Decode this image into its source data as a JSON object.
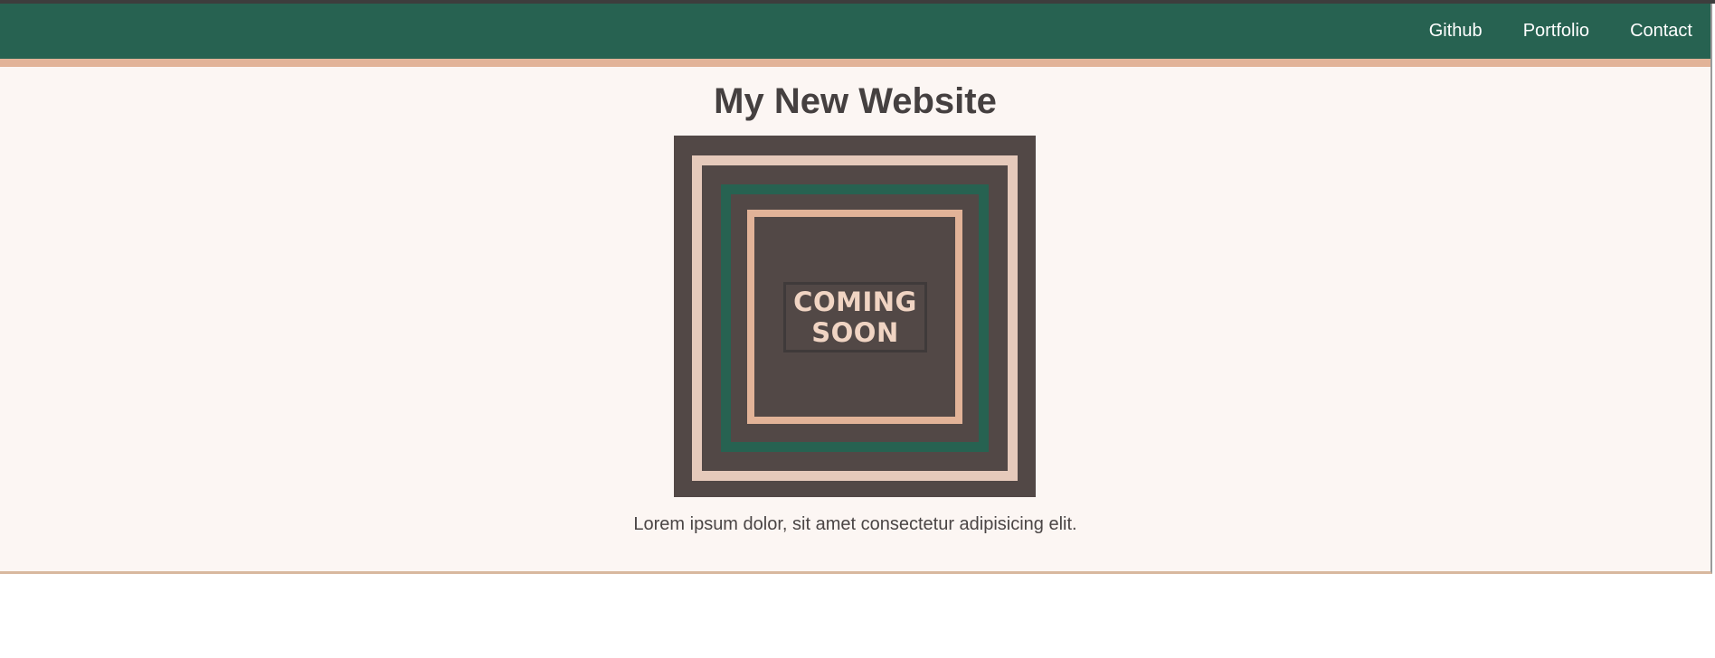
{
  "nav": {
    "links": [
      "Github",
      "Portfolio",
      "Contact"
    ]
  },
  "header": {
    "title": "My New Website"
  },
  "hero": {
    "badge_text": "COMING SOON",
    "badge_line1": "COMING",
    "badge_line2": "SOON"
  },
  "main": {
    "caption": "Lorem ipsum dolor, sit amet consectetur adipisicing elit."
  },
  "colors": {
    "nav_bg": "#276251",
    "nav_accent": "#e2b398",
    "page_bg": "#fcf6f3",
    "image_bg": "#524846",
    "text": "#454040"
  }
}
